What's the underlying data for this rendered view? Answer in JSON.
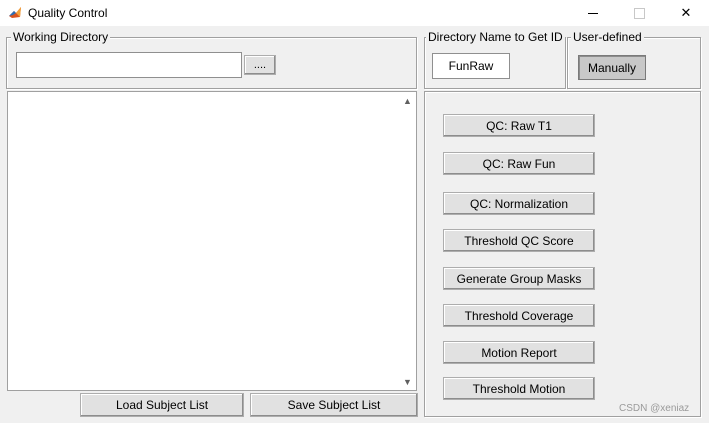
{
  "window": {
    "title": "Quality Control",
    "minimize_label": "",
    "maximize_label": "",
    "close_label": "✕"
  },
  "working_directory": {
    "title": "Working Directory",
    "value": "",
    "browse_label": "...."
  },
  "directory_name": {
    "title": "Directory Name to Get ID",
    "value": "FunRaw"
  },
  "user_defined": {
    "title": "User-defined",
    "button_label": "Manually"
  },
  "subject_list": {
    "items": [],
    "load_label": "Load Subject List",
    "save_label": "Save Subject List"
  },
  "qc_buttons": [
    {
      "label": "QC: Raw T1"
    },
    {
      "label": "QC: Raw Fun"
    },
    {
      "label": "QC: Normalization"
    },
    {
      "label": "Threshold QC Score"
    },
    {
      "label": "Generate Group Masks"
    },
    {
      "label": "Threshold Coverage"
    },
    {
      "label": "Motion Report"
    },
    {
      "label": "Threshold Motion"
    }
  ],
  "icons": {
    "app": "matlab-icon",
    "scroll_up": "chevron-up-icon",
    "scroll_down": "chevron-down-icon"
  },
  "watermark": "CSDN @xeniaz"
}
